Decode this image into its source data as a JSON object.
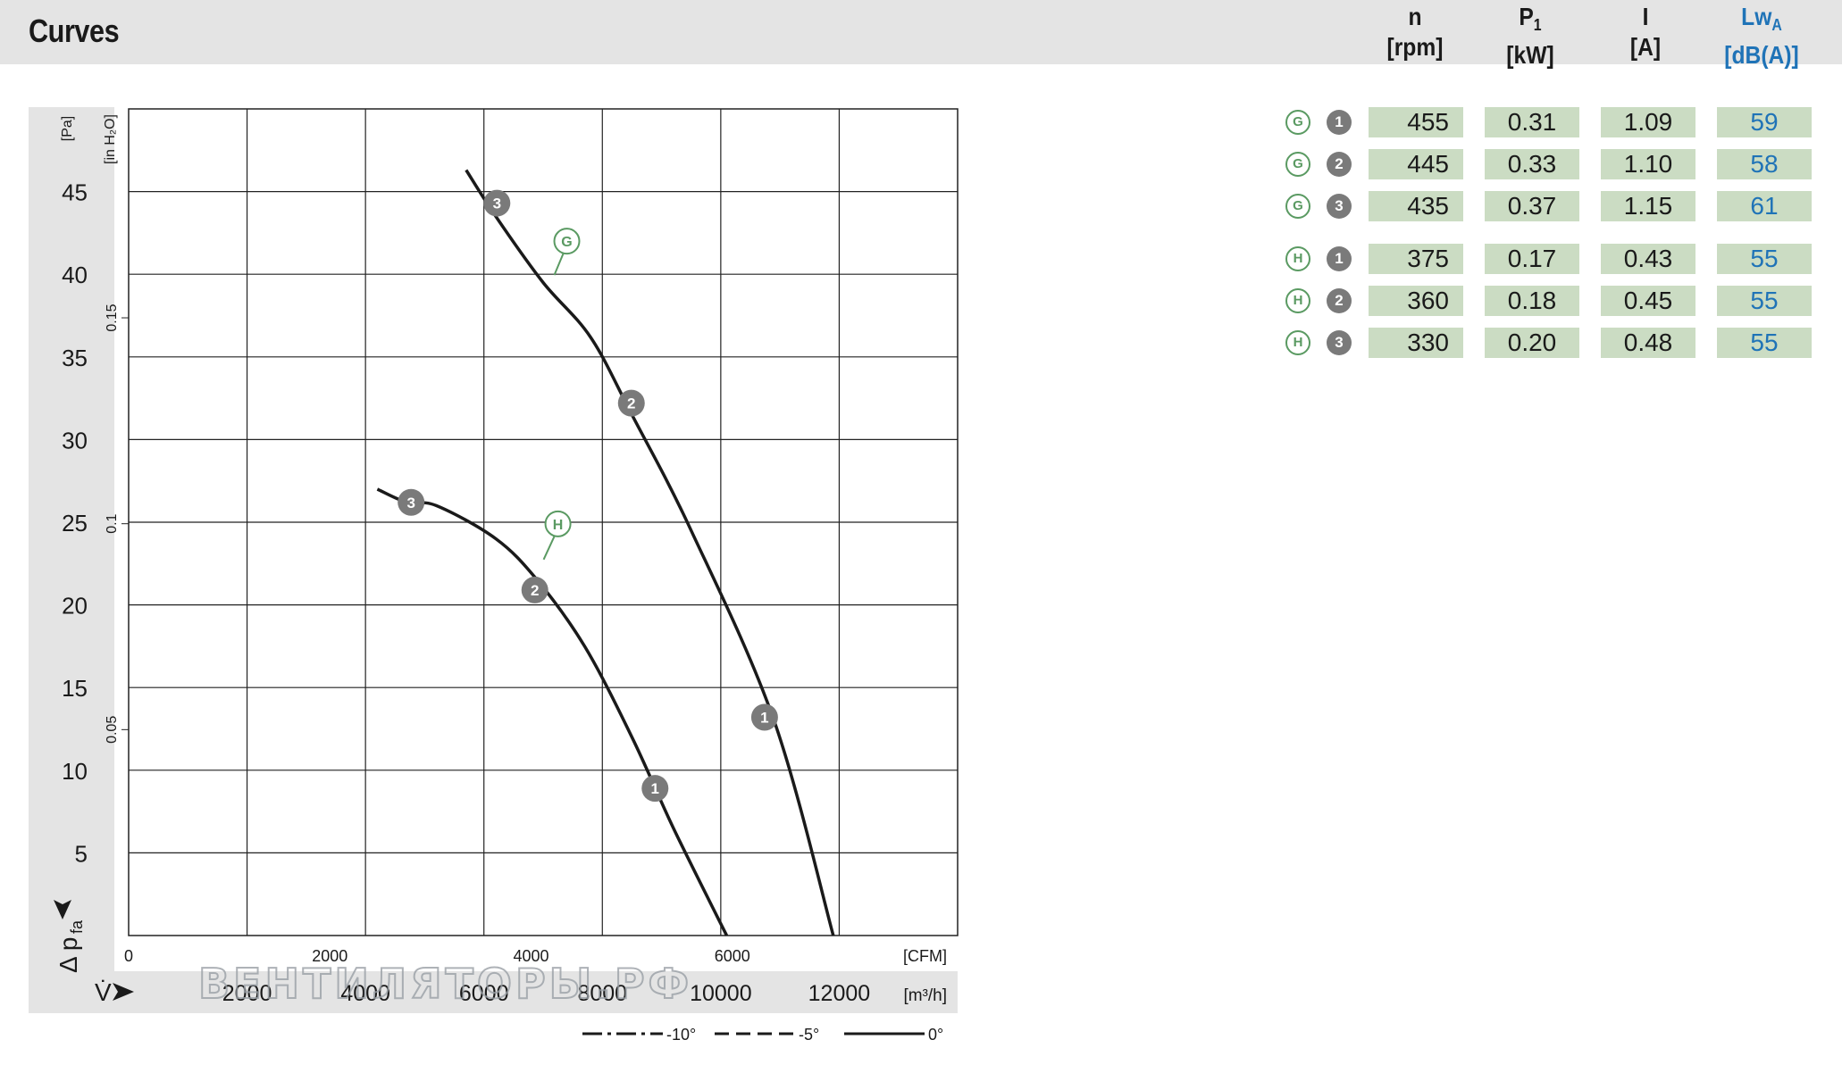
{
  "header": {
    "title": "Curves",
    "columns": [
      {
        "name": "n",
        "unit": "[rpm]"
      },
      {
        "name": "P",
        "sub": "1",
        "unit": "[kW]"
      },
      {
        "name": "I",
        "unit": "[A]"
      },
      {
        "name": "Lw",
        "sub": "A",
        "unit": "[dB(A)]"
      }
    ]
  },
  "table": {
    "rows": [
      {
        "curve": "G",
        "point": "1",
        "n": "455",
        "p1": "0.31",
        "i": "1.09",
        "lwa": "59"
      },
      {
        "curve": "G",
        "point": "2",
        "n": "445",
        "p1": "0.33",
        "i": "1.10",
        "lwa": "58"
      },
      {
        "curve": "G",
        "point": "3",
        "n": "435",
        "p1": "0.37",
        "i": "1.15",
        "lwa": "61"
      },
      {
        "curve": "H",
        "point": "1",
        "n": "375",
        "p1": "0.17",
        "i": "0.43",
        "lwa": "55"
      },
      {
        "curve": "H",
        "point": "2",
        "n": "360",
        "p1": "0.18",
        "i": "0.45",
        "lwa": "55"
      },
      {
        "curve": "H",
        "point": "3",
        "n": "330",
        "p1": "0.20",
        "i": "0.48",
        "lwa": "55"
      }
    ]
  },
  "colors": {
    "header_bg": "#e4e4e4",
    "axis_band": "#e4e4e4",
    "cell_bg": "#cbdcc3",
    "lwa_text": "#1f73b7",
    "curve_badge": "#5a9a62",
    "point_badge": "#7a7a7a"
  },
  "chart_data": {
    "type": "line",
    "x_unit": "[m³/h]",
    "x_ticks": [
      "2000",
      "4000",
      "6000",
      "8000",
      "10000",
      "12000"
    ],
    "x2_unit": "[CFM]",
    "x2_ticks": [
      "0",
      "2000",
      "4000",
      "6000"
    ],
    "y_unit": "[Pa]",
    "y_ticks": [
      "5",
      "10",
      "15",
      "20",
      "25",
      "30",
      "35",
      "40",
      "45"
    ],
    "y2_unit": "[in H₂O]",
    "y2_ticks": [
      "0.05",
      "0.1",
      "0.15"
    ],
    "xlim": [
      0,
      14000
    ],
    "ylim": [
      0,
      50
    ],
    "grid": true,
    "series": [
      {
        "name": "G",
        "points": [
          [
            5700,
            46.3
          ],
          [
            6200,
            43.5
          ],
          [
            7000,
            39.5
          ],
          [
            7800,
            36.2
          ],
          [
            8500,
            31.5
          ],
          [
            9500,
            24.5
          ],
          [
            10900,
            13.0
          ],
          [
            11900,
            0
          ]
        ],
        "operating_points": [
          {
            "label": "3",
            "x": 6220,
            "y": 44.3
          },
          {
            "label": "2",
            "x": 8490,
            "y": 32.2
          },
          {
            "label": "1",
            "x": 10740,
            "y": 13.2
          }
        ],
        "tag_at": {
          "x": 7400,
          "y": 42.0
        }
      },
      {
        "name": "H",
        "points": [
          [
            4200,
            27.0
          ],
          [
            4700,
            26.2
          ],
          [
            5200,
            26.0
          ],
          [
            6200,
            24.0
          ],
          [
            6900,
            21.5
          ],
          [
            7700,
            17.5
          ],
          [
            8500,
            12.0
          ],
          [
            9200,
            6.5
          ],
          [
            10100,
            0
          ]
        ],
        "operating_points": [
          {
            "label": "3",
            "x": 4770,
            "y": 26.2
          },
          {
            "label": "2",
            "x": 6860,
            "y": 20.9
          },
          {
            "label": "1",
            "x": 8890,
            "y": 8.9
          }
        ],
        "tag_at": {
          "x": 7250,
          "y": 24.9
        }
      }
    ],
    "legend": [
      {
        "style": "dash-dot",
        "label": "-10°"
      },
      {
        "style": "dashed",
        "label": "-5°"
      },
      {
        "style": "solid",
        "label": "0°"
      }
    ],
    "x_axis_symbol": "V̇",
    "y_axis_symbol": "Δ p",
    "y_axis_symbol_sub": "fa",
    "watermark": "ВЕНТИЛЯТОРЫ.РФ"
  }
}
